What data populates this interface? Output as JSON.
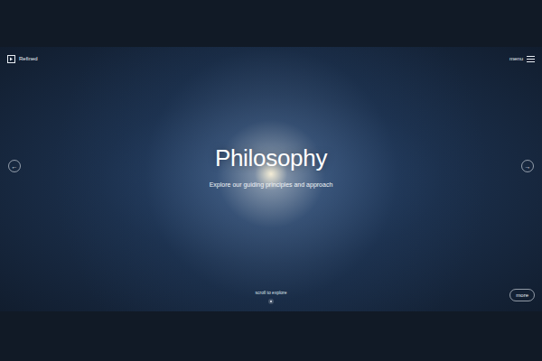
{
  "brand": {
    "name": "Refined"
  },
  "menu": {
    "label": "menu"
  },
  "slide": {
    "title": "Philosophy",
    "subtitle": "Explore our guiding principles and approach"
  },
  "nav": {
    "prev": "←",
    "next": "→"
  },
  "scroll": {
    "label": "scroll to explore"
  },
  "more": {
    "label": "more"
  }
}
